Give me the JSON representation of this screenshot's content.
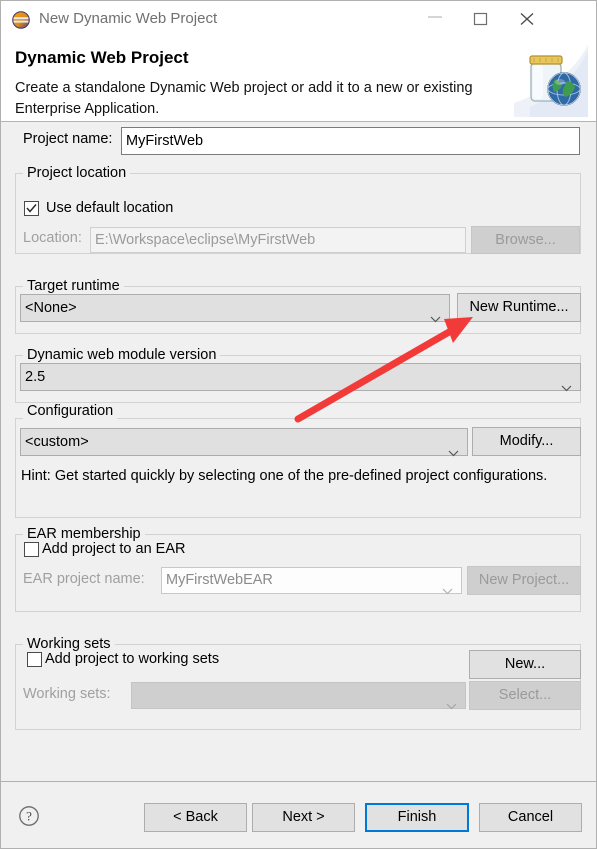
{
  "window": {
    "title": "New Dynamic Web Project",
    "icon": "eclipse-logo-icon",
    "minimize_label": "Minimize",
    "maximize_label": "Maximize",
    "close_label": "Close"
  },
  "header": {
    "title": "Dynamic Web Project",
    "description": "Create a standalone Dynamic Web project or add it to a new or existing Enterprise Application.",
    "icon": "web-archive-jar-globe-icon"
  },
  "form": {
    "project_name_label": "Project name:",
    "project_name_value": "MyFirstWeb",
    "project_location": {
      "group_title": "Project location",
      "use_default_label": "Use default location",
      "use_default_checked": true,
      "location_label": "Location:",
      "location_value": "E:\\Workspace\\eclipse\\MyFirstWeb",
      "browse_label": "Browse..."
    },
    "target_runtime": {
      "group_title": "Target runtime",
      "selected": "<None>",
      "new_runtime_label": "New Runtime..."
    },
    "module_version": {
      "group_title": "Dynamic web module version",
      "selected": "2.5"
    },
    "configuration": {
      "group_title": "Configuration",
      "selected": "<custom>",
      "modify_label": "Modify...",
      "hint": "Hint: Get started quickly by selecting one of the pre-defined project configurations."
    },
    "ear_membership": {
      "group_title": "EAR membership",
      "add_to_ear_label": "Add project to an EAR",
      "add_to_ear_checked": false,
      "ear_project_name_label": "EAR project name:",
      "ear_project_name_value": "MyFirstWebEAR",
      "new_project_label": "New Project..."
    },
    "working_sets": {
      "group_title": "Working sets",
      "add_to_working_sets_label": "Add project to working sets",
      "add_to_working_sets_checked": false,
      "working_sets_label": "Working sets:",
      "working_sets_value": "",
      "new_label": "New...",
      "select_label": "Select..."
    }
  },
  "footer": {
    "help_icon": "question-mark-help-icon",
    "back_label": "< Back",
    "next_label": "Next >",
    "finish_label": "Finish",
    "cancel_label": "Cancel"
  },
  "annotation": {
    "type": "red-arrow",
    "points_to": "New Runtime...",
    "color": "#f23b38"
  }
}
